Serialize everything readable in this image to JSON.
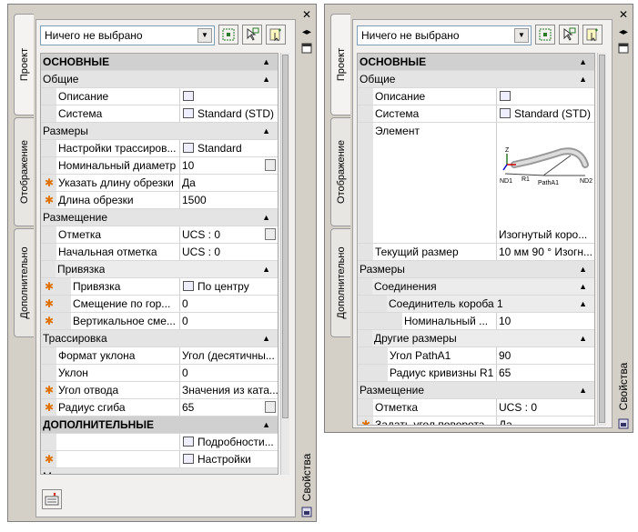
{
  "left": {
    "tabs": [
      "Проект",
      "Отображение",
      "Дополнительно"
    ],
    "title": "Свойства",
    "selector": "Ничего не выбрано",
    "rows": [
      {
        "type": "sec",
        "label": "ОСНОВНЫЕ",
        "glyph": "▲"
      },
      {
        "type": "cat",
        "label": "Общие",
        "glyph": "▲"
      },
      {
        "type": "prop",
        "name": "Описание",
        "value": "",
        "icon": true
      },
      {
        "type": "prop",
        "name": "Система",
        "value": "Standard (STD)",
        "icon": true
      },
      {
        "type": "cat",
        "label": "Размеры",
        "glyph": "▲"
      },
      {
        "type": "prop",
        "name": "Настройки трассиров...",
        "value": "Standard",
        "icon": true
      },
      {
        "type": "prop",
        "name": "Номинальный диаметр",
        "value": "10",
        "lock": true
      },
      {
        "type": "prop",
        "name": "Указать длину обрезки",
        "value": "Да",
        "star": true
      },
      {
        "type": "prop",
        "name": "Длина обрезки",
        "value": "1500",
        "star": true
      },
      {
        "type": "cat",
        "label": "Размещение",
        "glyph": "▲"
      },
      {
        "type": "prop",
        "name": "Отметка",
        "value": "UCS : 0",
        "lock": true
      },
      {
        "type": "prop",
        "name": "Начальная отметка",
        "value": "UCS : 0"
      },
      {
        "type": "sub",
        "label": "Привязка",
        "glyph": "▲"
      },
      {
        "type": "prop2",
        "name": "Привязка",
        "value": "По центру",
        "icon": true,
        "star": true
      },
      {
        "type": "prop2",
        "name": "Смещение по гор...",
        "value": "0",
        "star": true
      },
      {
        "type": "prop2",
        "name": "Вертикальное сме...",
        "value": "0",
        "star": true
      },
      {
        "type": "cat",
        "label": "Трассировка",
        "glyph": "▲"
      },
      {
        "type": "prop",
        "name": "Формат уклона",
        "value": "Угол (десятичны..."
      },
      {
        "type": "prop",
        "name": "Уклон",
        "value": "0"
      },
      {
        "type": "prop",
        "name": "Угол отвода",
        "value": "Значения из ката...",
        "star": true
      },
      {
        "type": "prop",
        "name": "Радиус сгиба",
        "value": "65",
        "star": true,
        "lock": true
      },
      {
        "type": "sec",
        "label": "ДОПОЛНИТЕЛЬНЫЕ",
        "glyph": "▲"
      },
      {
        "type": "prop",
        "name": "",
        "value": "Подробности...",
        "icon": true
      },
      {
        "type": "prop",
        "name": "",
        "value": "Настройки",
        "icon": true,
        "star": true
      },
      {
        "type": "cat",
        "label": "Метки и стрелки направления потока",
        "glyph": "▲"
      }
    ]
  },
  "right": {
    "tabs": [
      "Проект",
      "Отображение",
      "Дополнительно"
    ],
    "title": "Свойства",
    "selector": "Ничего не выбрано",
    "preview": {
      "nd1": "ND1",
      "r1": "R1",
      "patha1": "PathA1",
      "nd2": "ND2",
      "z": "Z"
    },
    "rows": [
      {
        "type": "sec",
        "label": "ОСНОВНЫЕ",
        "glyph": "▲"
      },
      {
        "type": "cat",
        "label": "Общие",
        "glyph": "▲"
      },
      {
        "type": "prop",
        "name": "Описание",
        "value": "",
        "icon": true
      },
      {
        "type": "prop",
        "name": "Система",
        "value": "Standard (STD)",
        "icon": true
      },
      {
        "type": "element",
        "name": "Элемент",
        "value": "Изогнутый коро..."
      },
      {
        "type": "prop",
        "name": "Текущий размер",
        "value": "10 мм 90 ° Изогн..."
      },
      {
        "type": "cat",
        "label": "Размеры",
        "glyph": "▲"
      },
      {
        "type": "sub",
        "label": "Соединения",
        "glyph": "▲"
      },
      {
        "type": "sub2",
        "label": "Соединитель короба 1",
        "glyph": "▲"
      },
      {
        "type": "prop3",
        "name": "Номинальный ...",
        "value": "10"
      },
      {
        "type": "sub",
        "label": "Другие размеры",
        "glyph": "▲"
      },
      {
        "type": "prop2",
        "name": "Угол PathA1",
        "value": "90"
      },
      {
        "type": "prop2",
        "name": "Радиус кривизны R1",
        "value": "65"
      },
      {
        "type": "cat",
        "label": "Размещение",
        "glyph": "▲"
      },
      {
        "type": "prop",
        "name": "Отметка",
        "value": "UCS : 0"
      },
      {
        "type": "prop",
        "name": "Задать угол поворота ...",
        "value": "Да",
        "star": true
      }
    ]
  }
}
